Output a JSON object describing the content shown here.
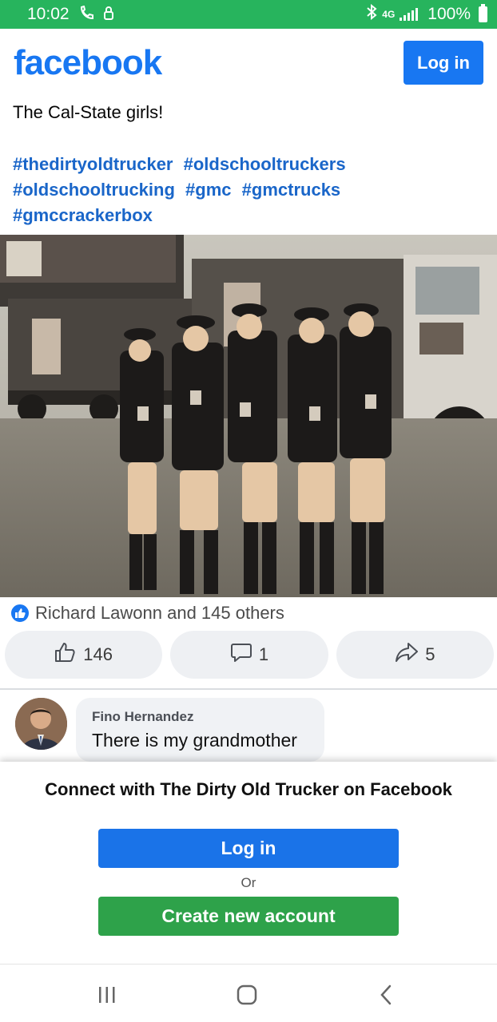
{
  "status_bar": {
    "time": "10:02",
    "network": "4G",
    "battery": "100%"
  },
  "header": {
    "logo": "facebook",
    "login_label": "Log in"
  },
  "post": {
    "text": "The Cal-State girls!",
    "hashtags": [
      "#thedirtyoldtrucker",
      "#oldschooltruckers",
      "#oldschooltrucking",
      "#gmc",
      "#gmctrucks",
      "#gmccrackerbox"
    ]
  },
  "reactions": {
    "summary": "Richard Lawonn and 145 others",
    "like_count": "146",
    "comment_count": "1",
    "share_count": "5"
  },
  "comment": {
    "author": "Fino Hernandez",
    "text": "There is my grandmother"
  },
  "sheet": {
    "title": "Connect with The Dirty Old Trucker on Facebook",
    "login_label": "Log in",
    "or_label": "Or",
    "create_label": "Create new account"
  },
  "colors": {
    "brand_blue": "#1877f2",
    "status_green": "#27b45d",
    "create_green": "#2ea24a",
    "hashtag_blue": "#1a66c9"
  }
}
